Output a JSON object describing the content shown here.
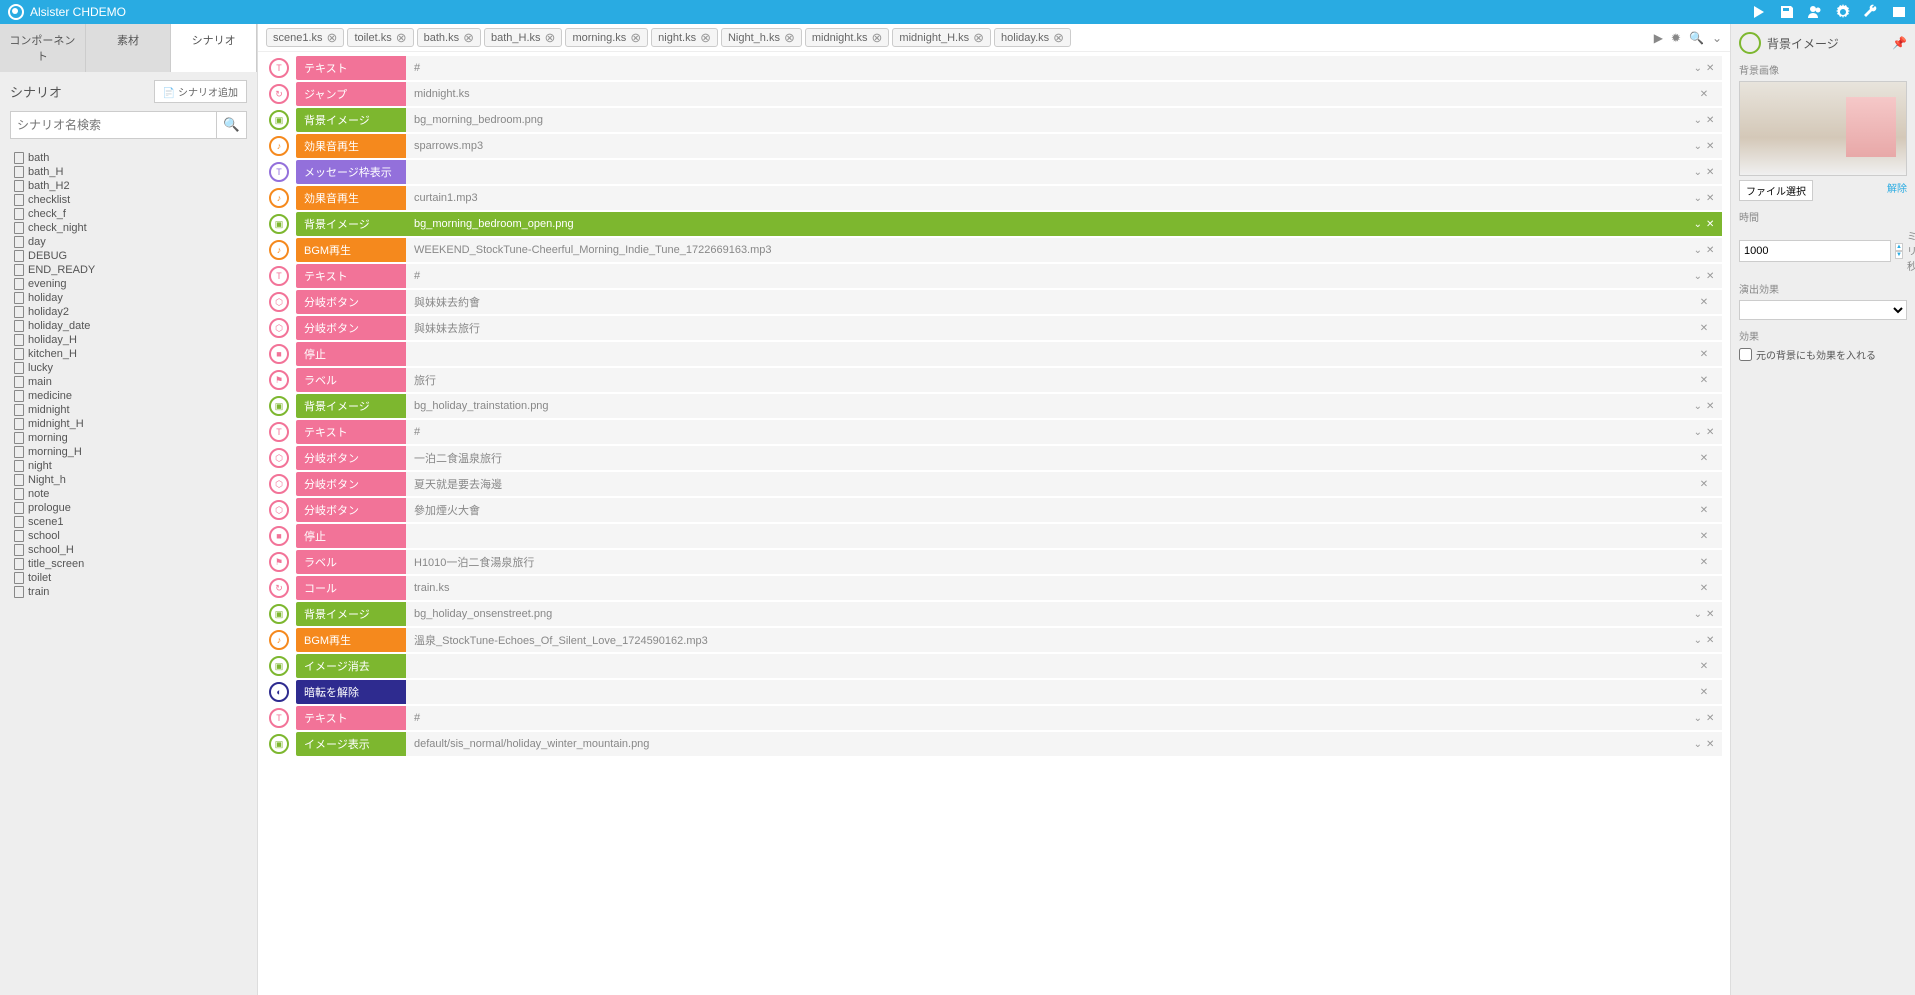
{
  "app_title": "Alsister CHDEMO",
  "sidebar": {
    "tabs": [
      "コンポーネント",
      "素材",
      "シナリオ"
    ],
    "active_tab": 2,
    "title": "シナリオ",
    "add_button": "シナリオ追加",
    "search_placeholder": "シナリオ名検索",
    "files": [
      "bath",
      "bath_H",
      "bath_H2",
      "checklist",
      "check_f",
      "check_night",
      "day",
      "DEBUG",
      "END_READY",
      "evening",
      "holiday",
      "holiday2",
      "holiday_date",
      "holiday_H",
      "kitchen_H",
      "lucky",
      "main",
      "medicine",
      "midnight",
      "midnight_H",
      "morning",
      "morning_H",
      "night",
      "Night_h",
      "note",
      "prologue",
      "scene1",
      "school",
      "school_H",
      "title_screen",
      "toilet",
      "train"
    ]
  },
  "open_tabs": [
    "scene1.ks",
    "toilet.ks",
    "bath.ks",
    "bath_H.ks",
    "morning.ks",
    "night.ks",
    "Night_h.ks",
    "midnight.ks",
    "midnight_H.ks",
    "holiday.ks"
  ],
  "rows": [
    {
      "type": "テキスト",
      "val": "#",
      "color": "pink",
      "icon": "T",
      "exp": true
    },
    {
      "type": "ジャンプ",
      "val": "midnight.ks",
      "color": "pink",
      "icon": "↻",
      "exp": false
    },
    {
      "type": "背景イメージ",
      "val": "bg_morning_bedroom.png",
      "color": "green",
      "icon": "▣",
      "exp": true
    },
    {
      "type": "効果音再生",
      "val": "sparrows.mp3",
      "color": "orange",
      "icon": "♪",
      "exp": true
    },
    {
      "type": "メッセージ枠表示",
      "val": "",
      "color": "purple",
      "icon": "T",
      "exp": true
    },
    {
      "type": "効果音再生",
      "val": "curtain1.mp3",
      "color": "orange",
      "icon": "♪",
      "exp": true
    },
    {
      "type": "背景イメージ",
      "val": "bg_morning_bedroom_open.png",
      "color": "green",
      "icon": "▣",
      "exp": true,
      "selected": true
    },
    {
      "type": "BGM再生",
      "val": "WEEKEND_StockTune-Cheerful_Morning_Indie_Tune_1722669163.mp3",
      "color": "orange",
      "icon": "♪",
      "exp": true
    },
    {
      "type": "テキスト",
      "val": "#",
      "color": "pink",
      "icon": "T",
      "exp": true
    },
    {
      "type": "分岐ボタン",
      "val": "與妹妹去約會",
      "color": "pink",
      "icon": "⬡",
      "exp": false
    },
    {
      "type": "分岐ボタン",
      "val": "與妹妹去旅行",
      "color": "pink",
      "icon": "⬡",
      "exp": false
    },
    {
      "type": "停止",
      "val": "",
      "color": "pink",
      "icon": "■",
      "exp": false
    },
    {
      "type": "ラベル",
      "val": "旅行",
      "color": "pink",
      "icon": "⚑",
      "exp": false
    },
    {
      "type": "背景イメージ",
      "val": "bg_holiday_trainstation.png",
      "color": "green",
      "icon": "▣",
      "exp": true
    },
    {
      "type": "テキスト",
      "val": "#",
      "color": "pink",
      "icon": "T",
      "exp": true
    },
    {
      "type": "分岐ボタン",
      "val": "一泊二食温泉旅行",
      "color": "pink",
      "icon": "⬡",
      "exp": false
    },
    {
      "type": "分岐ボタン",
      "val": "夏天就是要去海邊",
      "color": "pink",
      "icon": "⬡",
      "exp": false
    },
    {
      "type": "分岐ボタン",
      "val": "參加煙火大會",
      "color": "pink",
      "icon": "⬡",
      "exp": false
    },
    {
      "type": "停止",
      "val": "",
      "color": "pink",
      "icon": "■",
      "exp": false
    },
    {
      "type": "ラベル",
      "val": "H1010一泊二食湯泉旅行",
      "color": "pink",
      "icon": "⚑",
      "exp": false
    },
    {
      "type": "コール",
      "val": "train.ks",
      "color": "pink",
      "icon": "↻",
      "exp": false
    },
    {
      "type": "背景イメージ",
      "val": "bg_holiday_onsenstreet.png",
      "color": "green",
      "icon": "▣",
      "exp": true
    },
    {
      "type": "BGM再生",
      "val": "溫泉_StockTune-Echoes_Of_Silent_Love_1724590162.mp3",
      "color": "orange",
      "icon": "♪",
      "exp": true
    },
    {
      "type": "イメージ消去",
      "val": "",
      "color": "green",
      "icon": "▣",
      "exp": false
    },
    {
      "type": "暗転を解除",
      "val": "",
      "color": "navy",
      "icon": "◐",
      "exp": false
    },
    {
      "type": "テキスト",
      "val": "#",
      "color": "pink",
      "icon": "T",
      "exp": true
    },
    {
      "type": "イメージ表示",
      "val": "default/sis_normal/holiday_winter_mountain.png",
      "color": "green",
      "icon": "▣",
      "exp": true
    }
  ],
  "rightpanel": {
    "title": "背景イメージ",
    "bg_label": "背景画像",
    "file_btn": "ファイル選択",
    "clear_btn": "解除",
    "time_label": "時間",
    "time_value": "1000",
    "time_unit": "ミリ秒",
    "effect_label": "演出効果",
    "effect2_label": "効果",
    "checkbox_label": "元の背景にも効果を入れる"
  }
}
